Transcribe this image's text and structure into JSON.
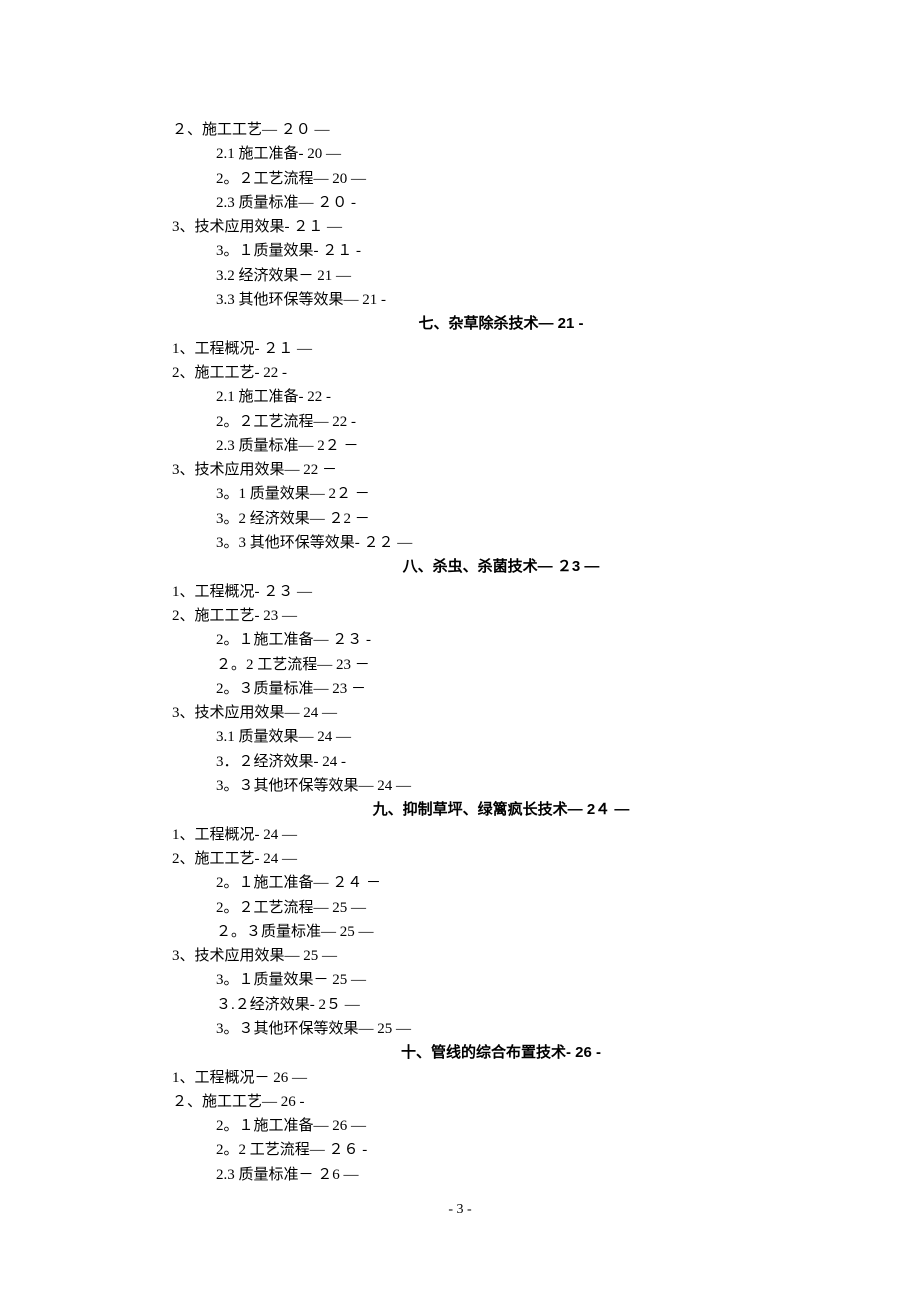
{
  "lines": [
    {
      "cls": "l1",
      "text": "２、施工工艺— ２０ —"
    },
    {
      "cls": "l2",
      "text": "2.1 施工准备- 20 —"
    },
    {
      "cls": "l2",
      "text": "2。２工艺流程— 20 —"
    },
    {
      "cls": "l2",
      "text": "2.3 质量标准—  ２０ -"
    },
    {
      "cls": "l1",
      "text": "3、技术应用效果-  ２１ —"
    },
    {
      "cls": "l2",
      "text": "3。１质量效果- ２１  -"
    },
    {
      "cls": "l2",
      "text": "3.2 经济效果－ 21 —"
    },
    {
      "cls": "l2",
      "text": "3.3 其他环保等效果— 21  -"
    },
    {
      "cls": "heading",
      "text": "七、杂草除杀技术— 21 -"
    },
    {
      "cls": "l1",
      "text": "1、工程概况- ２１ —"
    },
    {
      "cls": "l1",
      "text": "2、施工工艺-  22  -"
    },
    {
      "cls": "l2",
      "text": "2.1 施工准备- 22 -"
    },
    {
      "cls": "l2",
      "text": "2。２工艺流程—  22 -"
    },
    {
      "cls": "l2",
      "text": "2.3 质量标准— 2２  －"
    },
    {
      "cls": "l1",
      "text": "3、技术应用效果— 22  －"
    },
    {
      "cls": "l2",
      "text": "3。1 质量效果— 2２  －"
    },
    {
      "cls": "l2",
      "text": " 3。2 经济效果—  ２2  －"
    },
    {
      "cls": "l2",
      "text": "3。3 其他环保等效果- ２２ —"
    },
    {
      "cls": "heading",
      "text": "八、杀虫、杀菌技术—  ２3  —"
    },
    {
      "cls": "l1",
      "text": "1、工程概况- ２３ —"
    },
    {
      "cls": "l1",
      "text": "2、施工工艺-  23 —"
    },
    {
      "cls": "l2",
      "text": "2。１施工准备— ２３ -"
    },
    {
      "cls": "l2",
      "text": " ２。2 工艺流程— 23  －"
    },
    {
      "cls": "l2",
      "text": "2。３质量标准— 23 －"
    },
    {
      "cls": "l1",
      "text": "3、技术应用效果— 24 —"
    },
    {
      "cls": "l2",
      "text": "3.1 质量效果—  24  —"
    },
    {
      "cls": "l2",
      "text": "3．２经济效果- 24  -"
    },
    {
      "cls": "l2",
      "text": "3。３其他环保等效果— 24 —"
    },
    {
      "cls": "heading",
      "text": "九、抑制草坪、绿篱疯长技术— 2４  —"
    },
    {
      "cls": "l1",
      "text": "1、工程概况-  24 —"
    },
    {
      "cls": "l1",
      "text": "2、施工工艺- 24  —"
    },
    {
      "cls": "l2",
      "text": " 2。１施工准备— ２４ －"
    },
    {
      "cls": "l2",
      "text": "2。２工艺流程— 25 —"
    },
    {
      "cls": "l2",
      "text": " ２。３质量标准—  25  —"
    },
    {
      "cls": "l1",
      "text": "3、技术应用效果— 25 —"
    },
    {
      "cls": "l2",
      "text": "3。１质量效果－  25  —"
    },
    {
      "cls": "l2",
      "text": " ３.２经济效果-  2５  —"
    },
    {
      "cls": "l2",
      "text": "3。３其他环保等效果—  25  —"
    },
    {
      "cls": "heading",
      "text": "十、管线的综合布置技术- 26 -"
    },
    {
      "cls": "l1",
      "text": "1、工程概况－ 26  —"
    },
    {
      "cls": "l1",
      "text": "２、施工工艺— 26 -"
    },
    {
      "cls": "l2",
      "text": "2。１施工准备— 26  —"
    },
    {
      "cls": "l2",
      "text": "2。2 工艺流程— ２６ -"
    },
    {
      "cls": "l2",
      "text": "2.3 质量标准－ ２6 —"
    }
  ],
  "footer": "- 3 -"
}
